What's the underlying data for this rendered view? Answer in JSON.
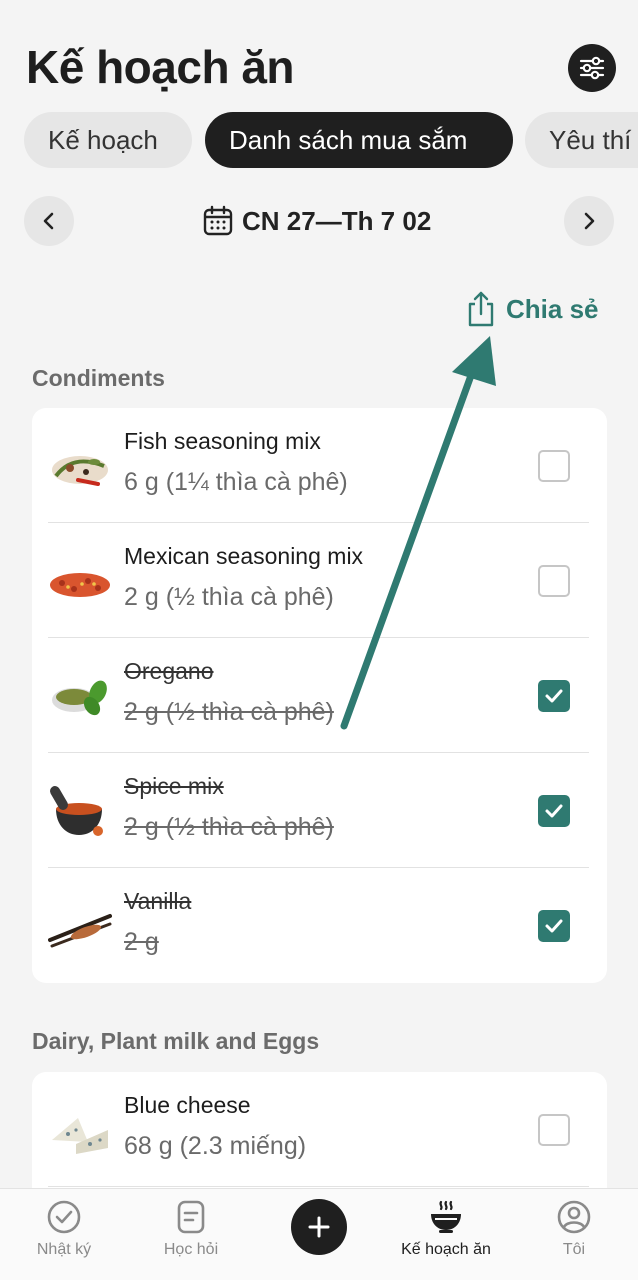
{
  "page_title": "Kế hoạch ăn",
  "tabs": [
    {
      "label": "Kế hoạch"
    },
    {
      "label": "Danh sách mua sắm"
    },
    {
      "label": "Yêu thí"
    }
  ],
  "week": {
    "label": "CN 27—Th 7 02"
  },
  "share_label": "Chia sẻ",
  "sections": [
    {
      "title": "Condiments",
      "items": [
        {
          "name": "Fish seasoning mix",
          "qty": "6 g (1¼ thìa cà phê)",
          "checked": false
        },
        {
          "name": "Mexican seasoning mix",
          "qty": "2 g (½ thìa cà phê)",
          "checked": false
        },
        {
          "name": "Oregano",
          "qty": "2 g (½ thìa cà phê)",
          "checked": true
        },
        {
          "name": "Spice mix",
          "qty": "2 g (½ thìa cà phê)",
          "checked": true
        },
        {
          "name": "Vanilla",
          "qty": "2 g",
          "checked": true
        }
      ]
    },
    {
      "title": "Dairy, Plant milk and Eggs",
      "items": [
        {
          "name": "Blue cheese",
          "qty": "68 g (2.3 miếng)",
          "checked": false
        }
      ]
    }
  ],
  "bottom_nav": [
    {
      "label": "Nhật ký",
      "icon": "check-circle-icon"
    },
    {
      "label": "Học hỏi",
      "icon": "document-icon"
    },
    {
      "label": "",
      "icon": "plus-icon"
    },
    {
      "label": "Kế hoạch ăn",
      "icon": "bowl-icon"
    },
    {
      "label": "Tôi",
      "icon": "user-icon"
    }
  ],
  "colors": {
    "accent": "#2f7a71",
    "dark": "#1f1f1f",
    "background": "#f4f4f4"
  }
}
